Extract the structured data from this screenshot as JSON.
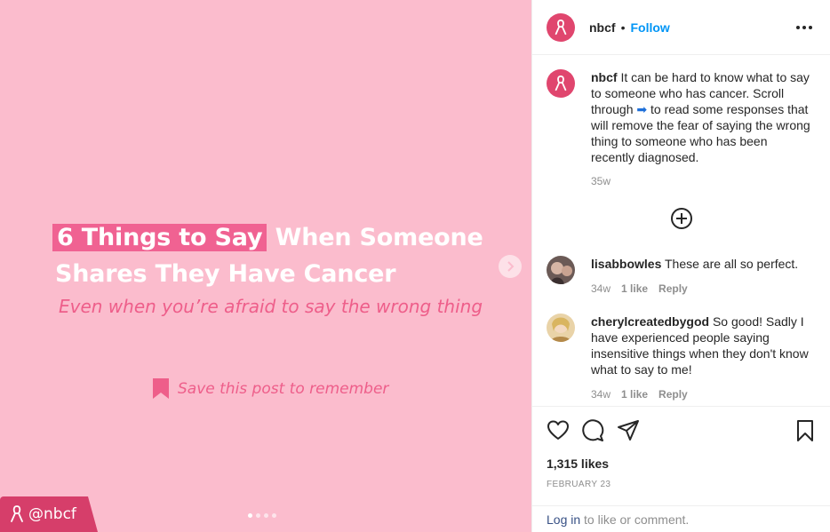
{
  "media": {
    "headline_highlight": "6 Things to Say",
    "headline_rest_1": " When Someone",
    "headline_line_2": "Shares They Have Cancer",
    "subline": "Even when you’re afraid to say the wrong thing",
    "save_text": "Save this post to remember",
    "handle": "@nbcf",
    "carousel_dots": 4,
    "active_dot": 0
  },
  "header": {
    "username": "nbcf",
    "separator": "•",
    "follow_label": "Follow"
  },
  "caption": {
    "username": "nbcf",
    "text_before_arrow": " It can be hard to know what to say to someone who has cancer. Scroll through ",
    "arrow": "➡",
    "text_after_arrow": " to read some responses that will remove the fear of saying the wrong thing to someone who has been recently diagnosed.",
    "age": "35w"
  },
  "comments": [
    {
      "username": "lisabbowles",
      "text": " These are all so perfect.",
      "age": "34w",
      "likes": "1 like",
      "reply": "Reply"
    },
    {
      "username": "cherylcreatedbygod",
      "text": " So good! Sadly I have experienced people saying insensitive things when they don't know what to say to me!",
      "age": "34w",
      "likes": "1 like",
      "reply": "Reply"
    }
  ],
  "stats": {
    "likes": "1,315 likes",
    "date": "FEBRUARY 23"
  },
  "login": {
    "link": "Log in",
    "rest": " to like or comment."
  },
  "colors": {
    "media_bg": "#fbbccd",
    "highlight": "#f06292",
    "accent_pink": "#ee5e8a",
    "brand": "#e0466e",
    "follow_blue": "#0095f6"
  },
  "icons": [
    "ribbon-icon",
    "more-icon",
    "plus-circle-icon",
    "heart-icon",
    "comment-icon",
    "share-icon",
    "bookmark-icon",
    "chevron-right-icon"
  ]
}
